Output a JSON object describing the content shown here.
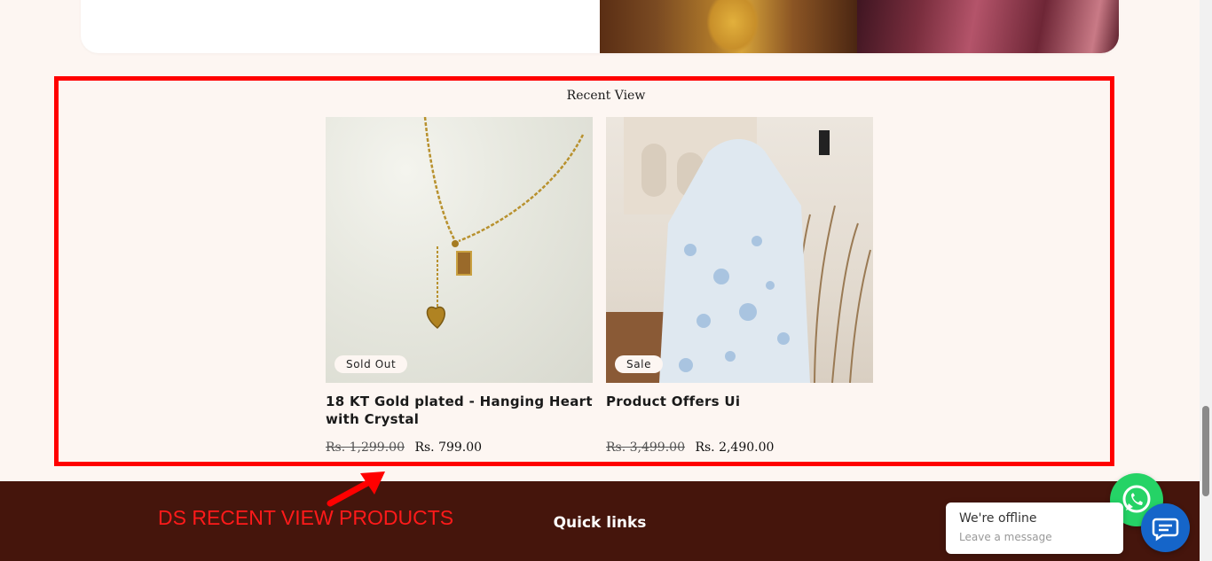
{
  "recent_view": {
    "title": "Recent View",
    "products": [
      {
        "badge": "Sold Out",
        "title": "18 KT Gold plated - Hanging Heart with Crystal",
        "price_original": "Rs. 1,299.00",
        "price_sale": "Rs. 799.00"
      },
      {
        "badge": "Sale",
        "title": "Product Offers Ui",
        "price_original": "Rs. 3,499.00",
        "price_sale": "Rs. 2,490.00"
      }
    ]
  },
  "annotation": {
    "label": "DS RECENT VIEW PRODUCTS",
    "color": "#ff0000"
  },
  "footer": {
    "heading": "Quick links",
    "background": "#45150c"
  },
  "chat": {
    "status": "We're offline",
    "prompt": "Leave a message",
    "whatsapp_icon": "whatsapp-icon",
    "chat_icon": "chat-bubble-icon"
  },
  "colors": {
    "page_bg": "#fdf6f2",
    "whatsapp": "#25d366",
    "chat_button": "#1565c9"
  }
}
